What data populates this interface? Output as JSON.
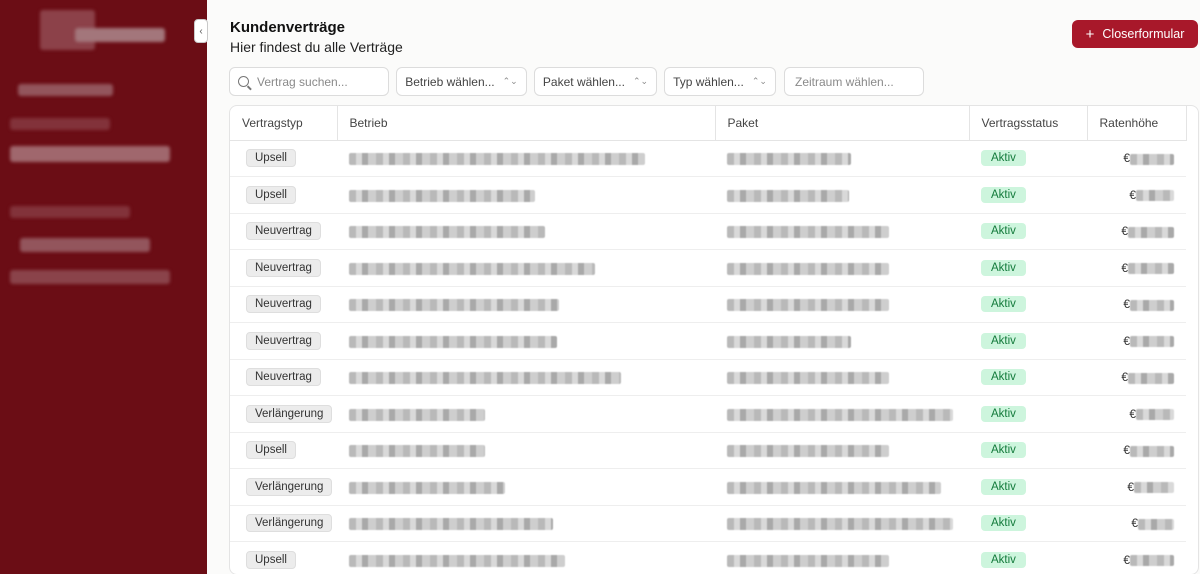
{
  "page": {
    "title": "Kundenverträge",
    "subtitle": "Hier findest du alle Verträge",
    "primary_button": "Closerformular"
  },
  "filters": {
    "search_placeholder": "Vertrag suchen...",
    "betrieb": "Betrieb wählen...",
    "paket": "Paket wählen...",
    "typ": "Typ wählen...",
    "zeitraum_placeholder": "Zeitraum wählen..."
  },
  "table": {
    "columns": [
      "Vertragstyp",
      "Betrieb",
      "Paket",
      "Vertragsstatus",
      "Ratenhöhe"
    ],
    "currency": "€",
    "rows": [
      {
        "typ": "Upsell",
        "status": "Aktiv"
      },
      {
        "typ": "Upsell",
        "status": "Aktiv"
      },
      {
        "typ": "Neuvertrag",
        "status": "Aktiv"
      },
      {
        "typ": "Neuvertrag",
        "status": "Aktiv"
      },
      {
        "typ": "Neuvertrag",
        "status": "Aktiv"
      },
      {
        "typ": "Neuvertrag",
        "status": "Aktiv"
      },
      {
        "typ": "Neuvertrag",
        "status": "Aktiv"
      },
      {
        "typ": "Verlängerung",
        "status": "Aktiv"
      },
      {
        "typ": "Upsell",
        "status": "Aktiv"
      },
      {
        "typ": "Verlängerung",
        "status": "Aktiv"
      },
      {
        "typ": "Verlängerung",
        "status": "Aktiv"
      },
      {
        "typ": "Upsell",
        "status": "Aktiv"
      }
    ]
  },
  "colors": {
    "sidebar": "#6b0d15",
    "primary": "#a8182a",
    "status_bg": "#cdf5dd",
    "status_text": "#137a3b"
  }
}
